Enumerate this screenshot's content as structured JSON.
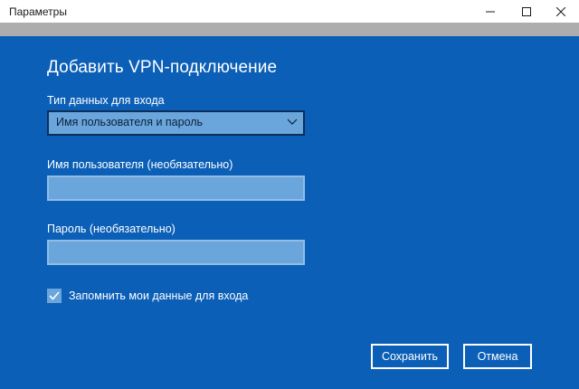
{
  "window": {
    "title": "Параметры",
    "controls": [
      "minimize-icon",
      "maximize-icon",
      "close-icon"
    ]
  },
  "dialog": {
    "heading": "Добавить VPN-подключение",
    "sign_in_type": {
      "label": "Тип данных для входа",
      "selected": "Имя пользователя и пароль"
    },
    "username": {
      "label": "Имя пользователя (необязательно)",
      "value": ""
    },
    "password": {
      "label": "Пароль (необязательно)",
      "value": ""
    },
    "remember": {
      "label": "Запомнить мои данные для входа",
      "checked": true
    },
    "buttons": {
      "save": "Сохранить",
      "cancel": "Отмена"
    }
  },
  "colors": {
    "dialog_background": "#0b5fb7",
    "input_background": "#6aa6dc",
    "text": "#ffffff"
  }
}
